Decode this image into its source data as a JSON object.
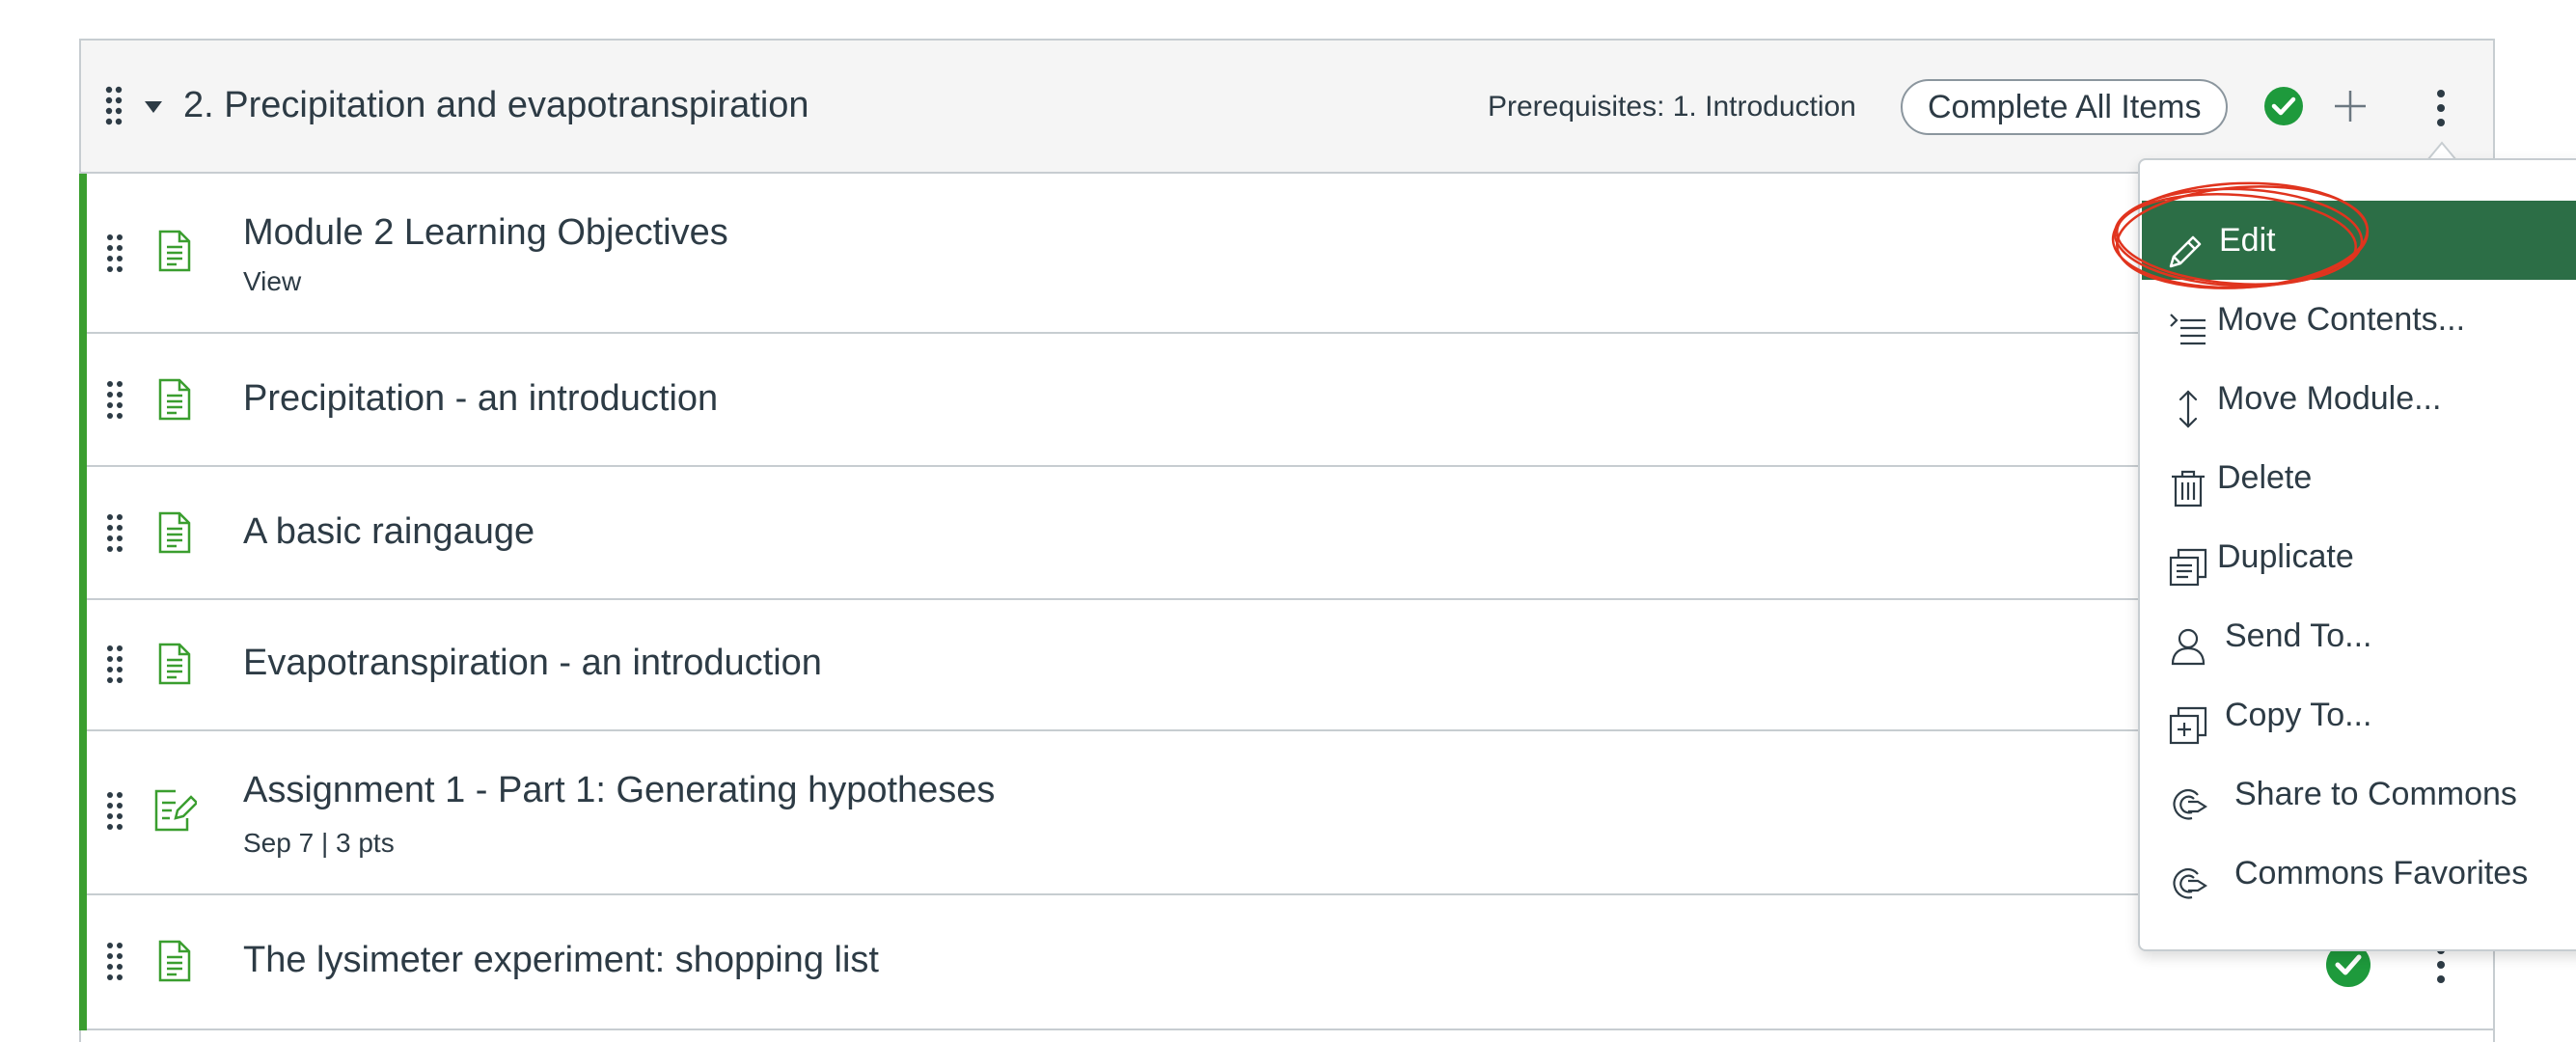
{
  "module": {
    "title": "2. Precipitation and evapotranspiration",
    "prerequisites": "Prerequisites: 1. Introduction",
    "requirement": "Complete All Items"
  },
  "items": [
    {
      "title": "Module 2 Learning Objectives",
      "subtitle": "View",
      "type": "page-icon"
    },
    {
      "title": "Precipitation - an introduction",
      "subtitle": "",
      "type": "page-icon"
    },
    {
      "title": "A basic raingauge",
      "subtitle": "",
      "type": "page-icon"
    },
    {
      "title": "Evapotranspiration - an introduction",
      "subtitle": "",
      "type": "page-icon"
    },
    {
      "title": "Assignment 1 - Part 1: Generating hypotheses",
      "subtitle": "Sep 7  |  3 pts",
      "type": "assignment-icon"
    },
    {
      "title": "The lysimeter experiment: shopping list",
      "subtitle": "",
      "type": "page-icon"
    }
  ],
  "menu": {
    "items": [
      {
        "label": "Edit",
        "icon": "pencil-icon"
      },
      {
        "label": "Move Contents...",
        "icon": "move-contents-icon"
      },
      {
        "label": "Move Module...",
        "icon": "updown-arrow-icon"
      },
      {
        "label": "Delete",
        "icon": "trash-icon"
      },
      {
        "label": "Duplicate",
        "icon": "duplicate-icon"
      },
      {
        "label": "Send To...",
        "icon": "user-icon"
      },
      {
        "label": "Copy To...",
        "icon": "copy-icon"
      },
      {
        "label": "Share to Commons",
        "icon": "commons-icon"
      },
      {
        "label": "Commons Favorites",
        "icon": "commons-icon"
      }
    ]
  },
  "colors": {
    "accent_green": "#3a9e2f",
    "menu_active": "#2c6e46",
    "complete_check": "#1e9a3c",
    "annotation_red": "#e0341e"
  }
}
